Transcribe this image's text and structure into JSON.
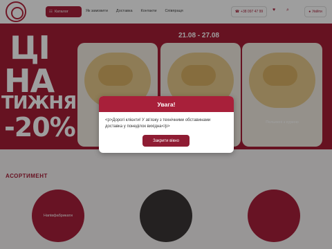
{
  "header": {
    "catalog_label": "Каталог",
    "catalog_icon": "grid-icon",
    "nav": [
      "Як замовити",
      "Доставка",
      "Контакти",
      "Співпраця"
    ],
    "phone": "+38 097 47 99",
    "login_label": "Увійти"
  },
  "banner": {
    "headline_line1": "ЦІ",
    "headline_line2": "НА",
    "headline_line3": "ТИЖНЯ",
    "discount": "-20%",
    "dates": "21.08 - 27.08",
    "cards": [
      {
        "caption": ""
      },
      {
        "caption": ""
      },
      {
        "caption": "Пельмені з куркою"
      }
    ]
  },
  "assortment": {
    "title": "АСОРТИМЕНТ",
    "categories": [
      "Напівфабрикати",
      "",
      ""
    ]
  },
  "modal": {
    "title": "Увага!",
    "message": "<p>Дорогі клієнти! У зв'язку з технічними обставинами доставка у понеділок вихідна</p>",
    "close_label": "Закрити вікно"
  },
  "colors": {
    "brand": "#a8203a",
    "banner": "#a51d36"
  }
}
